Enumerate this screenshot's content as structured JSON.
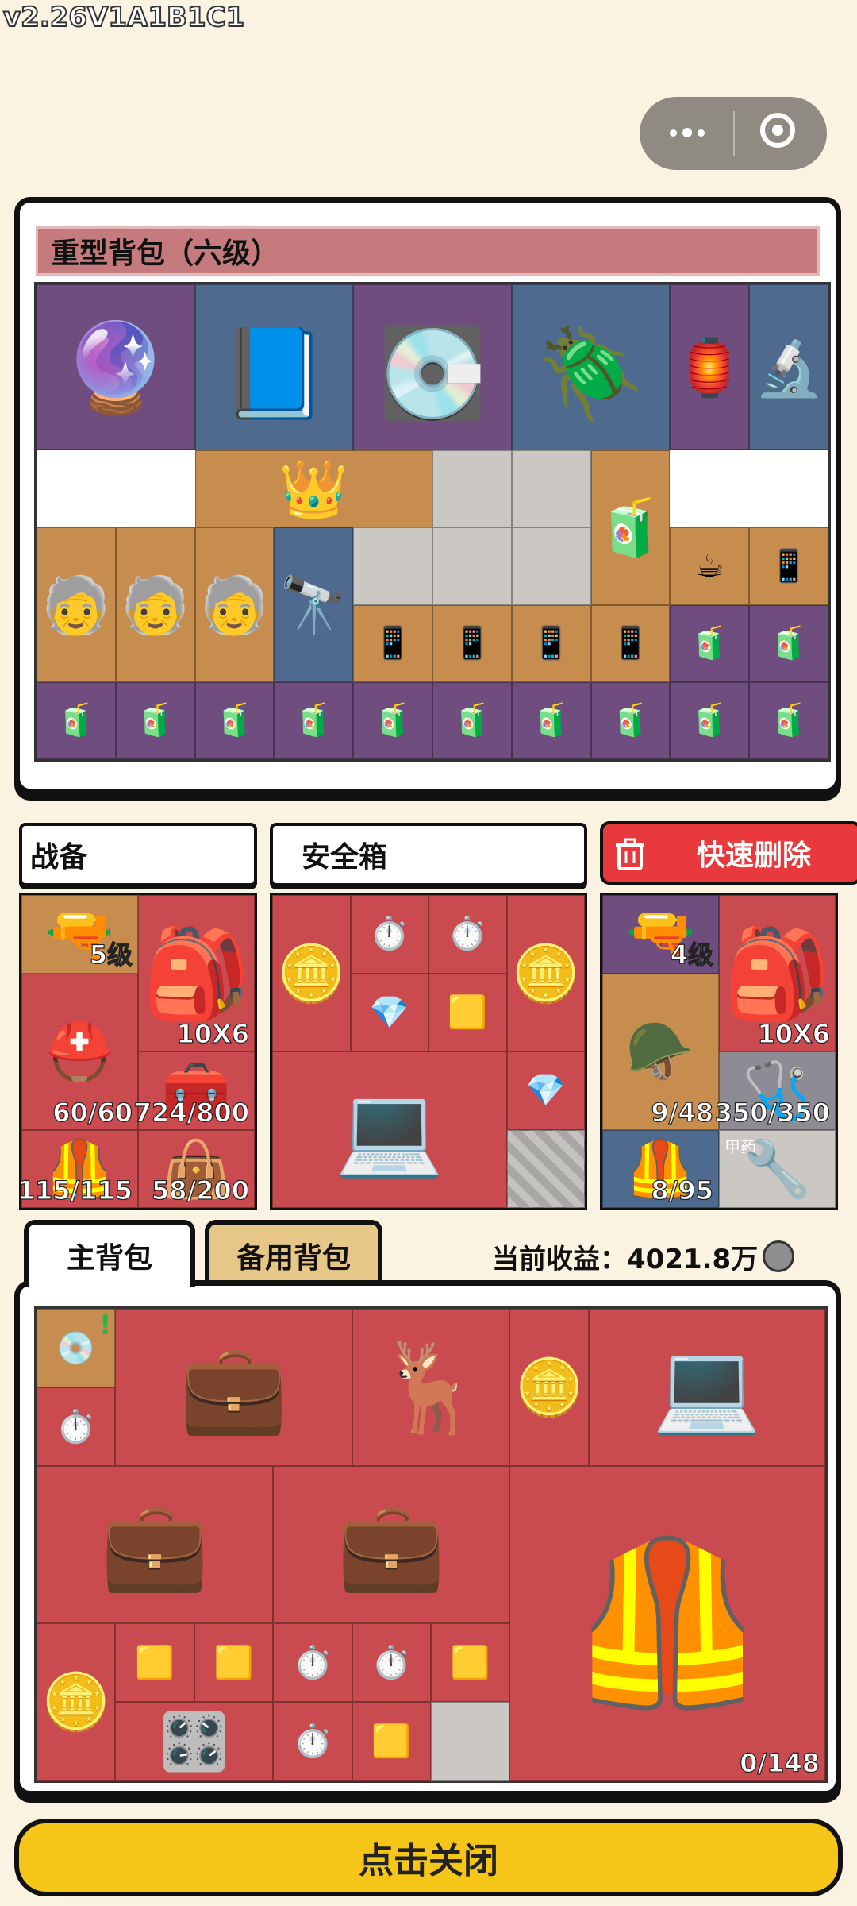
{
  "version": "v2.26V1A1B1C1",
  "capsule": {
    "more_icon": "more-dots-icon",
    "close_icon": "target-icon"
  },
  "backpack": {
    "title": "重型背包（六级）",
    "items": [
      {
        "icon": "🔮",
        "name": "dodecahedron-crystal"
      },
      {
        "icon": "📘",
        "name": "comic-book"
      },
      {
        "icon": "💽",
        "name": "circuit-board"
      },
      {
        "icon": "🪲",
        "name": "mech-bug"
      },
      {
        "icon": "🏮",
        "name": "lantern"
      },
      {
        "icon": "🔬",
        "name": "microscope"
      },
      {
        "icon": "👑",
        "name": "crown"
      },
      {
        "icon": "🧃",
        "name": "coffee-box"
      },
      {
        "icon": "☕",
        "name": "coffee-cup"
      },
      {
        "icon": "📱",
        "name": "phone"
      },
      {
        "icon": "🧓",
        "name": "figurine"
      },
      {
        "icon": "🔭",
        "name": "binoculars"
      },
      {
        "icon": "🧃",
        "name": "juice-box"
      }
    ]
  },
  "gear": {
    "title": "战备",
    "weapon_level": "5级",
    "backpack_size": "10X6",
    "helmet": "60/60",
    "case": "724/800",
    "armor": "115/115",
    "bag": "58/200"
  },
  "safebox": {
    "title": "安全箱"
  },
  "quick_delete": {
    "label": "快速删除"
  },
  "enemy_gear": {
    "weapon_level": "4级",
    "backpack_size": "10X6",
    "helmet": "9/48",
    "medkit": "350/350",
    "armor": "8/95",
    "empty_slot_label": "甲药"
  },
  "tabs": {
    "main": "主背包",
    "spare": "备用背包"
  },
  "income": {
    "label": "当前收益：",
    "value": "4021.8万"
  },
  "main_bag": {
    "capacity": "0/148"
  },
  "close": {
    "label": "点击关闭"
  },
  "colors": {
    "purple": "#6f4d7e",
    "blue": "#4e6a8e",
    "orange": "#c68d4e",
    "red": "#c94a4f",
    "yellow": "#f5c518"
  }
}
